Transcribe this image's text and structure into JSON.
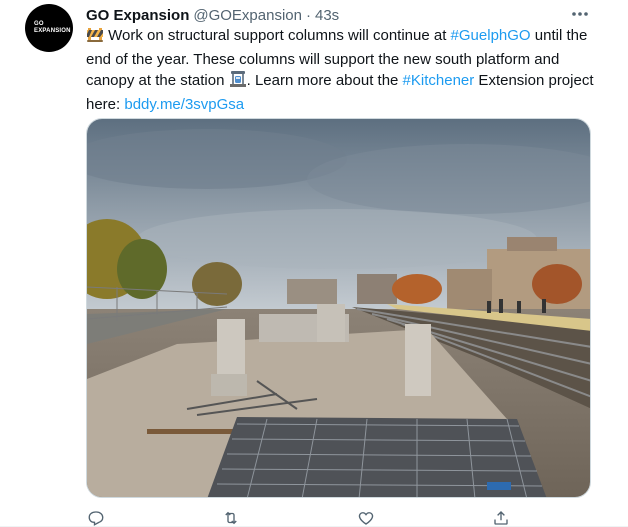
{
  "tweet": {
    "avatar_text": [
      "GO",
      "EXPANSION"
    ],
    "display_name": "GO Expansion",
    "handle": "@GOExpansion",
    "separator": "·",
    "timestamp": "43s",
    "text": {
      "p1": " Work on structural support columns will continue at ",
      "hashtag1": "#GuelphGO",
      "p2": " until the end of the year. These columns will support the new south platform and canopy at the station ",
      "p3": ". Learn more about the ",
      "hashtag2": "#Kitchener",
      "p4": " Extension project here: ",
      "url": "bddy.me/3svpGsa"
    },
    "media_icon": "photo-construction-site",
    "actions": [
      "reply-icon",
      "retweet-icon",
      "like-icon",
      "share-icon"
    ]
  },
  "colors": {
    "link": "#1d9bf0",
    "muted": "#536471",
    "text": "#0f1419"
  }
}
